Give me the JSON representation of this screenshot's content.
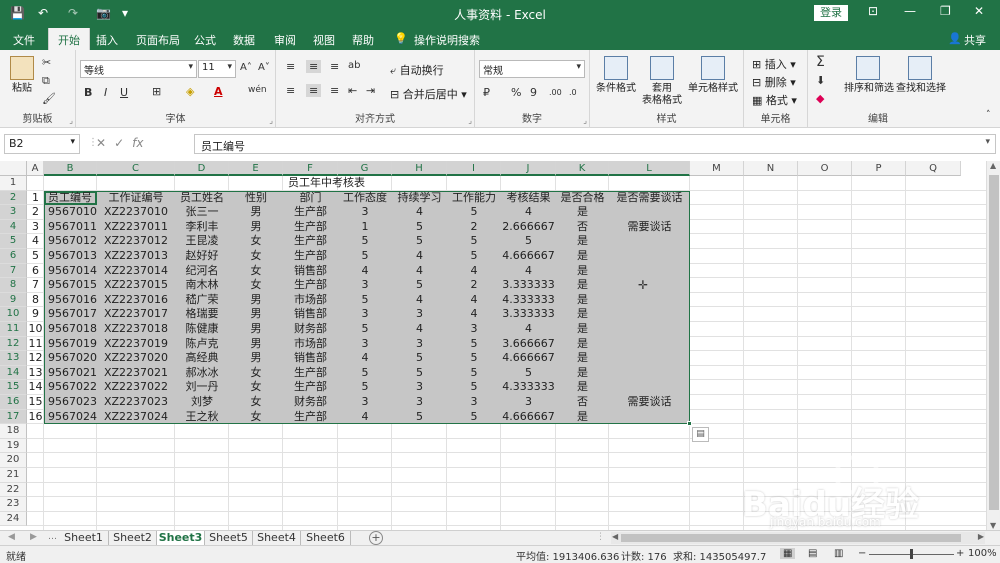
{
  "titlebar": {
    "doc_title": "人事资料  -  Excel",
    "login_label": "登录",
    "quick_save": "💾",
    "quick_undo": "↶",
    "quick_redo": "↷",
    "quick_camera": "📷",
    "quick_more": "▾",
    "opt_icon": "⊡",
    "min_icon": "—",
    "max_icon": "❐",
    "close_icon": "✕"
  },
  "ribbon_tabs": [
    "文件",
    "开始",
    "插入",
    "页面布局",
    "公式",
    "数据",
    "审阅",
    "视图",
    "帮助"
  ],
  "search_label": "操作说明搜索",
  "share_label": "共享",
  "ribbon": {
    "clipboard": {
      "label": "剪贴板",
      "paste": "粘贴"
    },
    "font": {
      "label": "字体",
      "name": "等线",
      "size": "11",
      "grow": "A˄",
      "shrink": "A˅",
      "bold": "B",
      "italic": "I",
      "underline": "U",
      "border": "⊞",
      "fill": "◈",
      "color": "A",
      "phonetic": "wén"
    },
    "alignment": {
      "label": "对齐方式",
      "wrap": "自动换行",
      "merge": "合并后居中",
      "orient": "ab"
    },
    "number": {
      "label": "数字",
      "format": "常规",
      "currency": "₽",
      "percent": "%",
      "comma": "9",
      "inc_dec": ".00",
      "dec_dec": ".0"
    },
    "styles": {
      "label": "样式",
      "conditional": "条件格式",
      "table_1": "套用",
      "table_2": "表格格式",
      "cell_styles": "单元格样式"
    },
    "cells": {
      "label": "单元格",
      "insert": "插入",
      "delete": "删除",
      "format": "格式"
    },
    "editing": {
      "label": "编辑",
      "sum": "Σ",
      "sort_filter": "排序和筛选",
      "find_select": "查找和选择"
    }
  },
  "formula_bar": {
    "name_box": "B2",
    "cancel": "✕",
    "enter": "✓",
    "fx": "fx",
    "content": "员工编号"
  },
  "columns": [
    "A",
    "B",
    "C",
    "D",
    "E",
    "F",
    "G",
    "H",
    "I",
    "J",
    "K",
    "L",
    "M",
    "N",
    "O",
    "P",
    "Q"
  ],
  "rows": [
    "1",
    "2",
    "3",
    "4",
    "5",
    "6",
    "7",
    "8",
    "9",
    "10",
    "11",
    "12",
    "13",
    "14",
    "15",
    "16",
    "17",
    "18",
    "19",
    "20",
    "21",
    "22",
    "23",
    "24"
  ],
  "sheet_title": "员工年中考核表",
  "table_headers": [
    "员工编号",
    "工作证编号",
    "员工姓名",
    "性别",
    "部门",
    "工作态度",
    "持续学习",
    "工作能力",
    "考核结果",
    "是否合格",
    "是否需要谈话"
  ],
  "table_rows": [
    {
      "idx": "1",
      "id": "9567010",
      "card": "XZ2237010",
      "name": "张三一",
      "sex": "男",
      "dept": "生产部",
      "att": "3",
      "learn": "4",
      "abil": "5",
      "result": "4",
      "pass": "是",
      "talk": ""
    },
    {
      "idx": "2",
      "id": "9567011",
      "card": "XZ2237011",
      "name": "李利丰",
      "sex": "男",
      "dept": "生产部",
      "att": "1",
      "learn": "5",
      "abil": "2",
      "result": "2.666667",
      "pass": "否",
      "talk": "需要谈话"
    },
    {
      "idx": "3",
      "id": "9567012",
      "card": "XZ2237012",
      "name": "王昆凌",
      "sex": "女",
      "dept": "生产部",
      "att": "5",
      "learn": "5",
      "abil": "5",
      "result": "5",
      "pass": "是",
      "talk": ""
    },
    {
      "idx": "4",
      "id": "9567013",
      "card": "XZ2237013",
      "name": "赵好好",
      "sex": "女",
      "dept": "生产部",
      "att": "5",
      "learn": "4",
      "abil": "5",
      "result": "4.666667",
      "pass": "是",
      "talk": ""
    },
    {
      "idx": "5",
      "id": "9567014",
      "card": "XZ2237014",
      "name": "纪河名",
      "sex": "女",
      "dept": "销售部",
      "att": "4",
      "learn": "4",
      "abil": "4",
      "result": "4",
      "pass": "是",
      "talk": ""
    },
    {
      "idx": "6",
      "id": "9567015",
      "card": "XZ2237015",
      "name": "南木林",
      "sex": "女",
      "dept": "生产部",
      "att": "3",
      "learn": "5",
      "abil": "2",
      "result": "3.333333",
      "pass": "是",
      "talk": ""
    },
    {
      "idx": "7",
      "id": "9567016",
      "card": "XZ2237016",
      "name": "嵇广荣",
      "sex": "男",
      "dept": "市场部",
      "att": "5",
      "learn": "4",
      "abil": "4",
      "result": "4.333333",
      "pass": "是",
      "talk": ""
    },
    {
      "idx": "8",
      "id": "9567017",
      "card": "XZ2237017",
      "name": "格瑞要",
      "sex": "男",
      "dept": "销售部",
      "att": "3",
      "learn": "3",
      "abil": "4",
      "result": "3.333333",
      "pass": "是",
      "talk": ""
    },
    {
      "idx": "9",
      "id": "9567018",
      "card": "XZ2237018",
      "name": "陈健康",
      "sex": "男",
      "dept": "财务部",
      "att": "5",
      "learn": "4",
      "abil": "3",
      "result": "4",
      "pass": "是",
      "talk": ""
    },
    {
      "idx": "10",
      "id": "9567019",
      "card": "XZ2237019",
      "name": "陈卢克",
      "sex": "男",
      "dept": "市场部",
      "att": "3",
      "learn": "3",
      "abil": "5",
      "result": "3.666667",
      "pass": "是",
      "talk": ""
    },
    {
      "idx": "11",
      "id": "9567020",
      "card": "XZ2237020",
      "name": "高经典",
      "sex": "男",
      "dept": "销售部",
      "att": "4",
      "learn": "5",
      "abil": "5",
      "result": "4.666667",
      "pass": "是",
      "talk": ""
    },
    {
      "idx": "12",
      "id": "9567021",
      "card": "XZ2237021",
      "name": "郝冰冰",
      "sex": "女",
      "dept": "生产部",
      "att": "5",
      "learn": "5",
      "abil": "5",
      "result": "5",
      "pass": "是",
      "talk": ""
    },
    {
      "idx": "13",
      "id": "9567022",
      "card": "XZ2237022",
      "name": "刘一丹",
      "sex": "女",
      "dept": "生产部",
      "att": "5",
      "learn": "3",
      "abil": "5",
      "result": "4.333333",
      "pass": "是",
      "talk": ""
    },
    {
      "idx": "14",
      "id": "9567023",
      "card": "XZ2237023",
      "name": "刘梦",
      "sex": "女",
      "dept": "财务部",
      "att": "3",
      "learn": "3",
      "abil": "3",
      "result": "3",
      "pass": "否",
      "talk": "需要谈话"
    },
    {
      "idx": "15",
      "id": "9567024",
      "card": "XZ2237024",
      "name": "王之秋",
      "sex": "女",
      "dept": "生产部",
      "att": "4",
      "learn": "5",
      "abil": "5",
      "result": "4.666667",
      "pass": "是",
      "talk": ""
    }
  ],
  "row_col_a": [
    "1",
    "2",
    "3",
    "4",
    "5",
    "6",
    "7",
    "8",
    "9",
    "10",
    "11",
    "12",
    "13",
    "14",
    "15",
    "16"
  ],
  "sheets": [
    "Sheet1",
    "Sheet2",
    "Sheet3",
    "Sheet5",
    "Sheet4",
    "Sheet6"
  ],
  "active_sheet": "Sheet3",
  "status": {
    "ready": "就绪",
    "average": "平均值: 1913406.636",
    "count": "计数: 176",
    "sum": "求和: 143505497.7",
    "zoom": "100%"
  },
  "watermark": {
    "text": "Baidu经验",
    "url": "jingyan.baidu.com"
  },
  "colors": {
    "accent": "#217346",
    "selection": "#c6c6c6"
  }
}
